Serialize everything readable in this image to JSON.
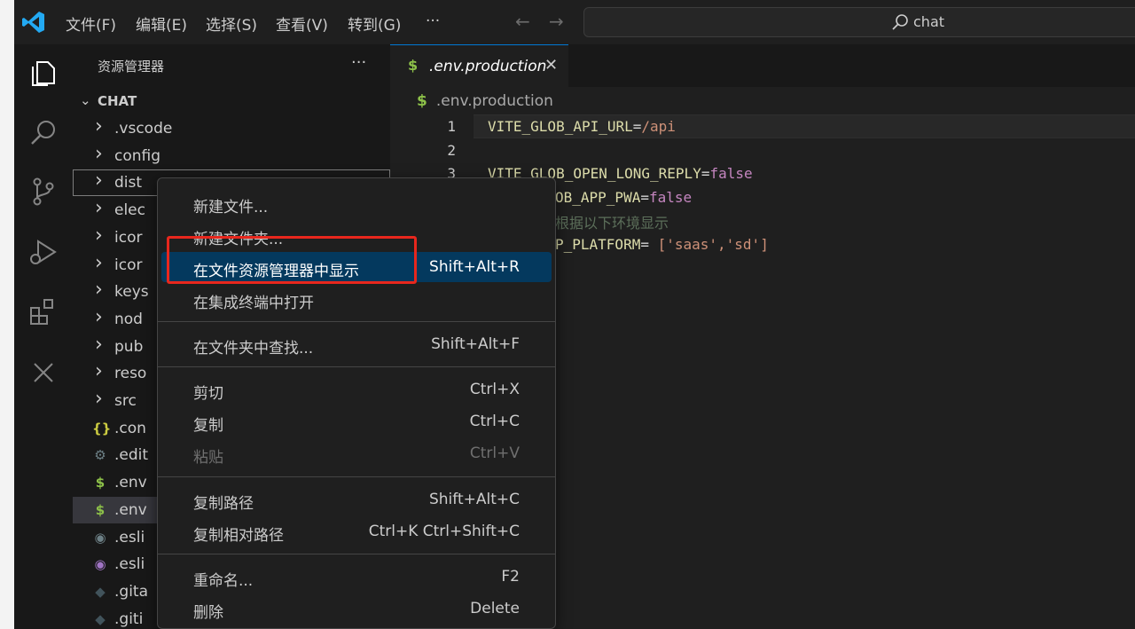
{
  "titlebar": {
    "menus": [
      "文件(F)",
      "编辑(E)",
      "选择(S)",
      "查看(V)",
      "转到(G)",
      "···"
    ],
    "search_text": "chat"
  },
  "activitybar": {
    "icons": [
      "files-icon",
      "search-icon",
      "source-control-icon",
      "run-debug-icon",
      "extensions-icon",
      "remote-explorer-icon"
    ]
  },
  "sidebar": {
    "title": "资源管理器",
    "more": "···",
    "section": "CHAT",
    "items": [
      {
        "label": ".vscode",
        "type": "folder"
      },
      {
        "label": "config",
        "type": "folder"
      },
      {
        "label": "dist",
        "type": "folder"
      },
      {
        "label": "elec",
        "type": "folder"
      },
      {
        "label": "icor",
        "type": "folder"
      },
      {
        "label": "icor",
        "type": "folder"
      },
      {
        "label": "keys",
        "type": "folder"
      },
      {
        "label": "nod",
        "type": "folder"
      },
      {
        "label": "pub",
        "type": "folder"
      },
      {
        "label": "reso",
        "type": "folder"
      },
      {
        "label": "src",
        "type": "folder"
      },
      {
        "label": ".con",
        "type": "file",
        "icon": "{}",
        "color": "#cbcb41"
      },
      {
        "label": ".edit",
        "type": "file",
        "icon": "⚙",
        "color": "#6d8086"
      },
      {
        "label": ".env",
        "type": "file",
        "icon": "$",
        "color": "#8dc149"
      },
      {
        "label": ".env",
        "type": "file",
        "icon": "$",
        "color": "#8dc149"
      },
      {
        "label": ".esli",
        "type": "file",
        "icon": "◉",
        "color": "#6d8086"
      },
      {
        "label": ".esli",
        "type": "file",
        "icon": "◉",
        "color": "#a074c4"
      },
      {
        "label": ".gita",
        "type": "file",
        "icon": "◆",
        "color": "#41535b"
      },
      {
        "label": ".giti",
        "type": "file",
        "icon": "◆",
        "color": "#41535b"
      }
    ]
  },
  "editor": {
    "tab_icon": "$",
    "tab_label": ".env.production",
    "tab_close": "✕",
    "breadcrumb_icon": "$",
    "breadcrumb": ".env.production",
    "line_numbers": [
      "1",
      "2",
      "3"
    ],
    "lines": {
      "l1": {
        "key": "VITE_GLOB_API_URL",
        "op": "=",
        "val": "/api"
      },
      "l3": {
        "key": "VITE_GLOB_OPEN_LONG_REPLY",
        "op": "=",
        "val": "false"
      },
      "l4": {
        "key": "OB_APP_PWA",
        "op": "=",
        "val": "false"
      },
      "l5": {
        "comment": "根据以下环境显示"
      },
      "l6": {
        "key": "P_PLATFORM",
        "op": "= ",
        "val": "['saas','sd']"
      }
    }
  },
  "context_menu": {
    "groups": [
      [
        {
          "label": "新建文件...",
          "shortcut": ""
        },
        {
          "label": "新建文件夹...",
          "shortcut": ""
        },
        {
          "label": "在文件资源管理器中显示",
          "shortcut": "Shift+Alt+R"
        },
        {
          "label": "在集成终端中打开",
          "shortcut": ""
        }
      ],
      [
        {
          "label": "在文件夹中查找...",
          "shortcut": "Shift+Alt+F"
        }
      ],
      [
        {
          "label": "剪切",
          "shortcut": "Ctrl+X"
        },
        {
          "label": "复制",
          "shortcut": "Ctrl+C"
        },
        {
          "label": "粘贴",
          "shortcut": "Ctrl+V"
        }
      ],
      [
        {
          "label": "复制路径",
          "shortcut": "Shift+Alt+C"
        },
        {
          "label": "复制相对路径",
          "shortcut": "Ctrl+K Ctrl+Shift+C"
        }
      ],
      [
        {
          "label": "重命名...",
          "shortcut": "F2"
        },
        {
          "label": "删除",
          "shortcut": "Delete"
        }
      ]
    ]
  },
  "colors": {
    "accent": "#0078d4",
    "annotation": "#e8271d",
    "menu_highlight": "#04395e"
  }
}
